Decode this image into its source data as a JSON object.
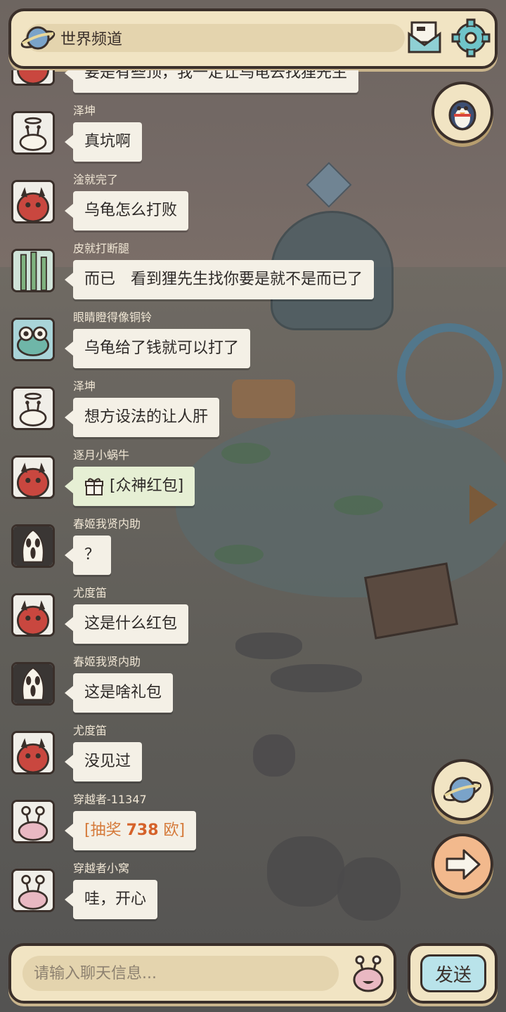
{
  "header": {
    "channel_title": "世界频道"
  },
  "messages": [
    {
      "name": "",
      "text": "要是有些顶，我一定让乌龟去找狸先生",
      "avatar": "demon"
    },
    {
      "name": "泽坤",
      "text": "真坑啊",
      "avatar": "snail-halo"
    },
    {
      "name": "淦就完了",
      "text": "乌龟怎么打败",
      "avatar": "demon"
    },
    {
      "name": "皮就打断腿",
      "text": "而已　看到狸先生找你要是就不是而已了",
      "avatar": "bamboo"
    },
    {
      "name": "眼睛瞪得像铜铃",
      "text": "乌龟给了钱就可以打了",
      "avatar": "frog"
    },
    {
      "name": "泽坤",
      "text": "想方设法的让人肝",
      "avatar": "snail-halo"
    },
    {
      "name": "逐月小蜗牛",
      "text": "[众神红包]",
      "avatar": "demon",
      "type": "redpacket"
    },
    {
      "name": "春姬我贤内助",
      "text": "？",
      "avatar": "ghostface"
    },
    {
      "name": "尤度笛",
      "text": "这是什么红包",
      "avatar": "demon"
    },
    {
      "name": "春姬我贤内助",
      "text": "这是啥礼包",
      "avatar": "ghostface"
    },
    {
      "name": "尤度笛",
      "text": "没见过",
      "avatar": "demon"
    },
    {
      "name": "穿越者-11347",
      "text_pre": "[抽奖 ",
      "text_num": "738",
      "text_post": " 欧]",
      "avatar": "snail-pink",
      "type": "lottery"
    },
    {
      "name": "穿越者小窝",
      "text": "哇，开心",
      "avatar": "snail-pink"
    }
  ],
  "input": {
    "placeholder": "请输入聊天信息..."
  },
  "send_label": "发送",
  "icons": {
    "planet": "planet-icon",
    "mail": "mail-icon",
    "settings": "gear-icon",
    "penguin": "penguin-icon",
    "arrow": "arrow-right-icon",
    "emoji": "snail-emoji-icon",
    "gift": "gift-icon"
  },
  "colors": {
    "panel": "#f1e4c3",
    "border": "#3a2f2a",
    "send_button": "#b9e3ea",
    "lottery_text": "#d57a3a"
  }
}
